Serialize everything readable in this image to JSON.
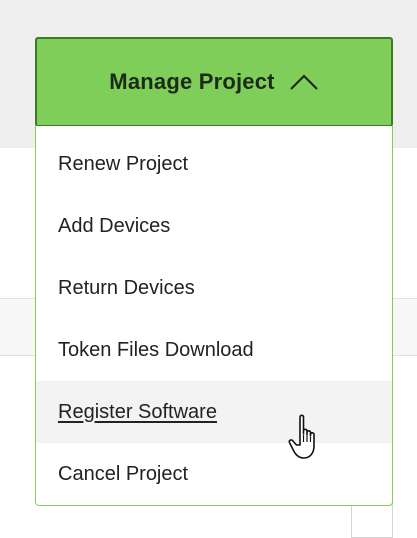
{
  "manage_button": {
    "label": "Manage Project",
    "icon": "chevron-up-icon",
    "state": "expanded"
  },
  "menu": {
    "items": [
      {
        "label": "Renew Project",
        "hovered": false
      },
      {
        "label": "Add Devices",
        "hovered": false
      },
      {
        "label": "Return Devices",
        "hovered": false
      },
      {
        "label": "Token Files Download",
        "hovered": false
      },
      {
        "label": "Register Software",
        "hovered": true
      },
      {
        "label": "Cancel Project",
        "hovered": false
      }
    ]
  },
  "cursor": {
    "icon": "hand-pointer-icon"
  },
  "colors": {
    "button_fill": "#7fce5a",
    "button_border": "#3f7a28",
    "hover_background": "#f3f3f3",
    "page_band": "#efefef"
  }
}
